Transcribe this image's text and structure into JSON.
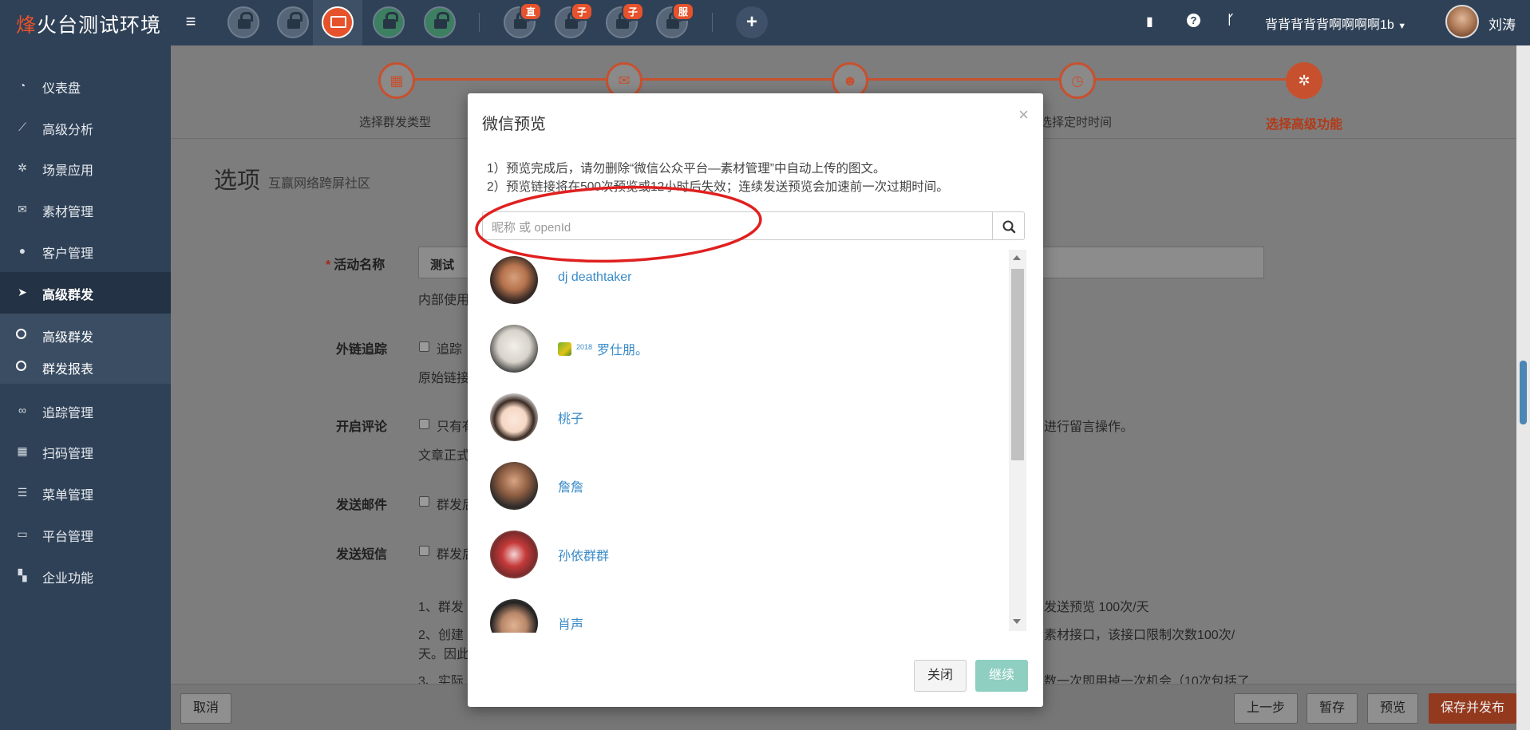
{
  "brand": {
    "highlight": "烽",
    "rest": "火台测试环境"
  },
  "topbar": {
    "apps": [
      {
        "icon": "lock-icon",
        "badge": ""
      },
      {
        "icon": "lock-icon",
        "badge": ""
      },
      {
        "icon": "screen-icon",
        "badge": ""
      },
      {
        "icon": "lock-icon",
        "badge": ""
      },
      {
        "icon": "lock-icon",
        "badge": ""
      },
      {
        "icon": "lock-icon",
        "badge": "直"
      },
      {
        "icon": "lock-icon",
        "badge": "子"
      },
      {
        "icon": "lock-icon",
        "badge": "子"
      },
      {
        "icon": "lock-icon",
        "badge": "服"
      }
    ],
    "plus": "+",
    "account": "背背背背背啊啊啊啊1b",
    "user": "刘涛"
  },
  "sidebar": {
    "items": [
      {
        "icon": "dashboard-icon",
        "label": "仪表盘"
      },
      {
        "icon": "chart-line-icon",
        "label": "高级分析"
      },
      {
        "icon": "gear-icon",
        "label": "场景应用"
      },
      {
        "icon": "envelope-icon",
        "label": "素材管理"
      },
      {
        "icon": "user-icon",
        "label": "客户管理"
      },
      {
        "icon": "paper-plane-icon",
        "label": "高级群发"
      },
      {
        "icon": "link-icon",
        "label": "追踪管理"
      },
      {
        "icon": "qrcode-icon",
        "label": "扫码管理"
      },
      {
        "icon": "list-icon",
        "label": "菜单管理"
      },
      {
        "icon": "desktop-icon",
        "label": "平台管理"
      },
      {
        "icon": "grid-icon",
        "label": "企业功能"
      }
    ],
    "sub": [
      {
        "label": "高级群发"
      },
      {
        "label": "群发报表"
      }
    ]
  },
  "steps": [
    "选择群发类型",
    "",
    "",
    "选择定时时间",
    "选择高级功能"
  ],
  "page": {
    "title": "选项",
    "subtitle": "互赢网络跨屏社区",
    "activity_label": "活动名称",
    "activity_value": "测试",
    "internal": "内部使用",
    "track_label": "外链追踪",
    "track_cb": "追踪",
    "track_orig": "原始链接",
    "comment_label": "开启评论",
    "comment_cb": "只有有",
    "comment_tail": "进行留言操作。",
    "comment_text": "文章正式",
    "email_label": "发送邮件",
    "email_cb": "群发后",
    "sms_label": "发送短信",
    "sms_cb": "群发后",
    "note1": "1、群发",
    "note1_tail": "发送预览 100次/天",
    "note2": "2、创建",
    "note2_tail": "素材接口，该接口限制次数100次/",
    "note2b": "天。因此",
    "note3": "3、实际",
    "note3_tail": "数一次即用掉一次机会（10次包括了"
  },
  "bottom": {
    "cancel": "取消",
    "prev": "上一步",
    "save": "暂存",
    "preview": "预览",
    "publish": "保存并发布"
  },
  "modal": {
    "title": "微信预览",
    "close": "×",
    "tip1": "1）预览完成后，请勿删除“微信公众平台—素材管理”中自动上传的图文。",
    "tip2": "2）预览链接将在500次预览或12小时后失效；连续发送预览会加速前一次过期时间。",
    "search_placeholder": "昵称 或 openId",
    "users": [
      {
        "name": "dj deathtaker",
        "sup": ""
      },
      {
        "name": "罗仕朋。",
        "sup": "2018"
      },
      {
        "name": "桃子",
        "sup": ""
      },
      {
        "name": "詹詹",
        "sup": ""
      },
      {
        "name": "孙依群群",
        "sup": ""
      },
      {
        "name": "肖声",
        "sup": ""
      }
    ],
    "btn_close": "关闭",
    "btn_continue": "继续"
  },
  "colors": {
    "accent": "#e6522c",
    "sidebar": "#2f4157",
    "link": "#3a8bc9",
    "annotation": "#e02020"
  }
}
